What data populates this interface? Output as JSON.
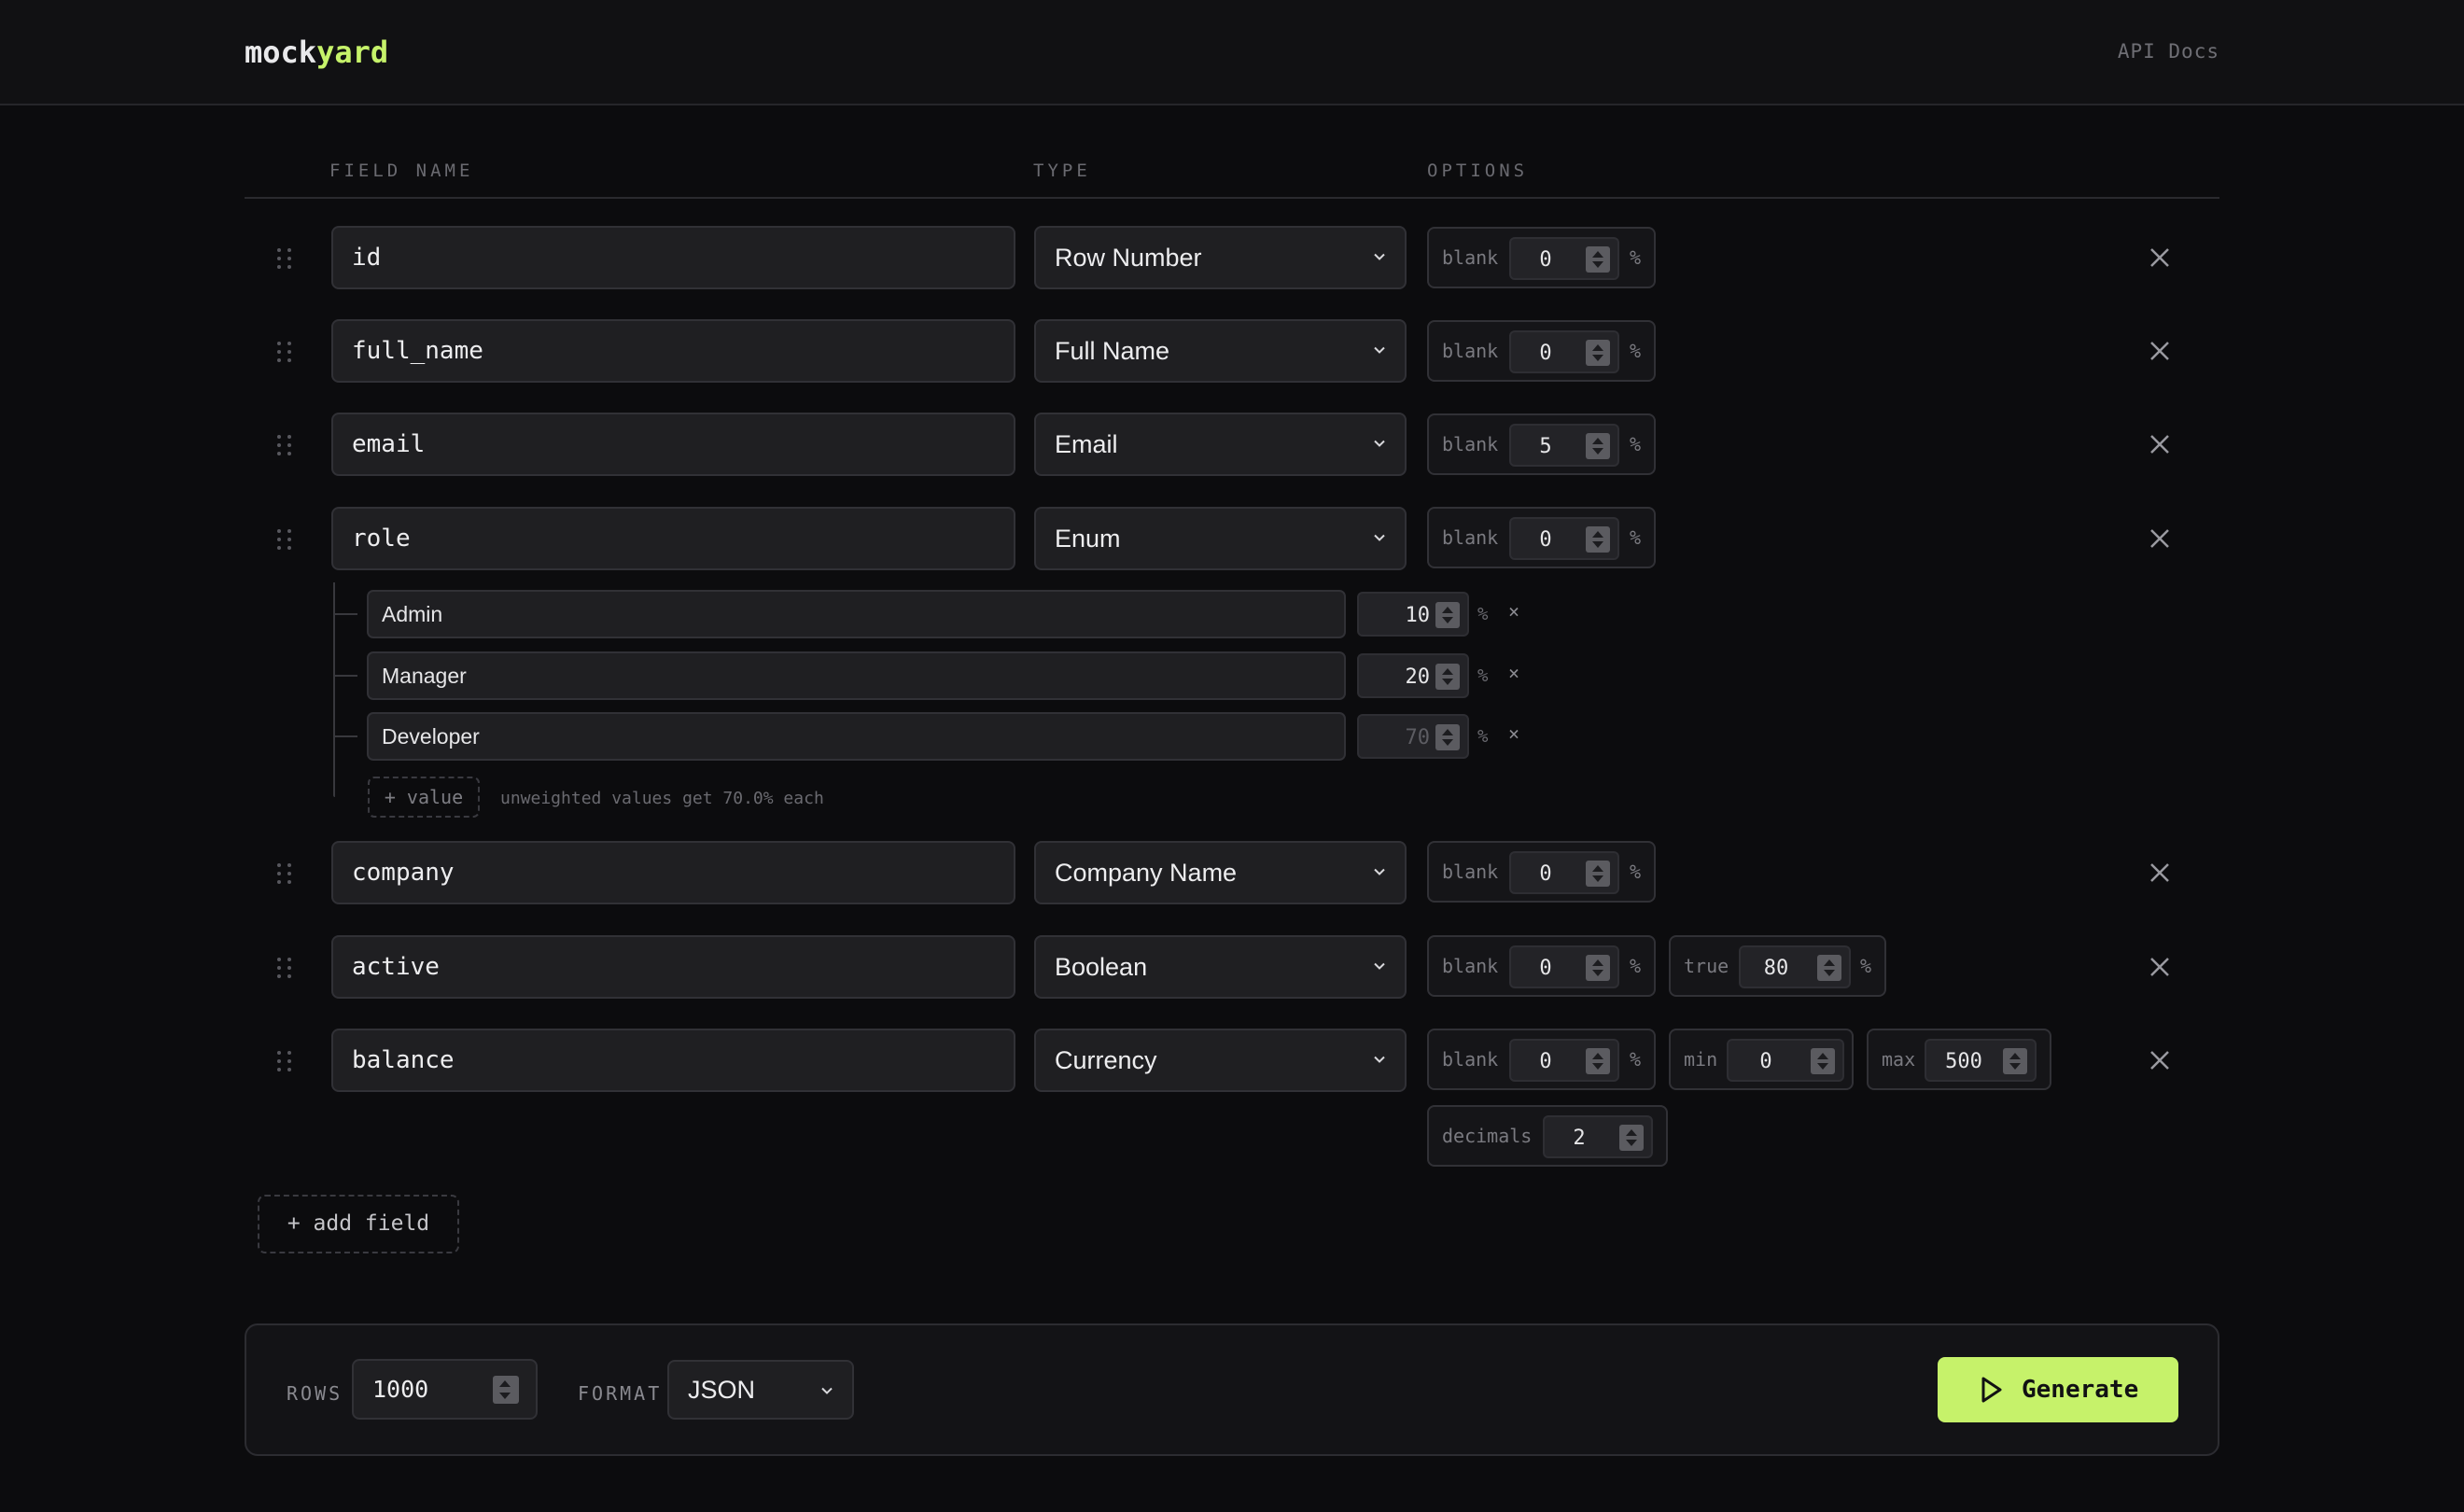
{
  "header": {
    "logo_part1": "mock",
    "logo_part2": "yard",
    "api_docs": "API Docs",
    "accent_color": "#c6f26a"
  },
  "columns": {
    "field_name": "FIELD NAME",
    "type": "TYPE",
    "options": "OPTIONS"
  },
  "fields": [
    {
      "name": "id",
      "type": "Row Number",
      "blank_label": "blank",
      "blank": "0",
      "pct": "%"
    },
    {
      "name": "full_name",
      "type": "Full Name",
      "blank_label": "blank",
      "blank": "0",
      "pct": "%"
    },
    {
      "name": "email",
      "type": "Email",
      "blank_label": "blank",
      "blank": "5",
      "pct": "%"
    },
    {
      "name": "role",
      "type": "Enum",
      "blank_label": "blank",
      "blank": "0",
      "pct": "%"
    },
    {
      "name": "company",
      "type": "Company Name",
      "blank_label": "blank",
      "blank": "0",
      "pct": "%"
    },
    {
      "name": "active",
      "type": "Boolean",
      "blank_label": "blank",
      "blank": "0",
      "pct": "%",
      "true_label": "true",
      "true_value": "80"
    },
    {
      "name": "balance",
      "type": "Currency",
      "blank_label": "blank",
      "blank": "0",
      "pct": "%",
      "min_label": "min",
      "min_value": "0",
      "max_label": "max",
      "max_value": "500",
      "decimals_label": "decimals",
      "decimals_value": "2"
    }
  ],
  "enum": {
    "values": [
      {
        "label": "Admin",
        "weight": "10",
        "placeholder": false
      },
      {
        "label": "Manager",
        "weight": "20",
        "placeholder": false
      },
      {
        "label": "Developer",
        "weight": "70",
        "placeholder": true
      }
    ],
    "pct": "%",
    "remove": "×",
    "add_value": "+ value",
    "hint": "unweighted values get 70.0% each"
  },
  "add_field": "+ add field",
  "footer": {
    "rows_label": "ROWS",
    "rows_value": "1000",
    "format_label": "FORMAT",
    "format_value": "JSON",
    "generate": "Generate"
  }
}
